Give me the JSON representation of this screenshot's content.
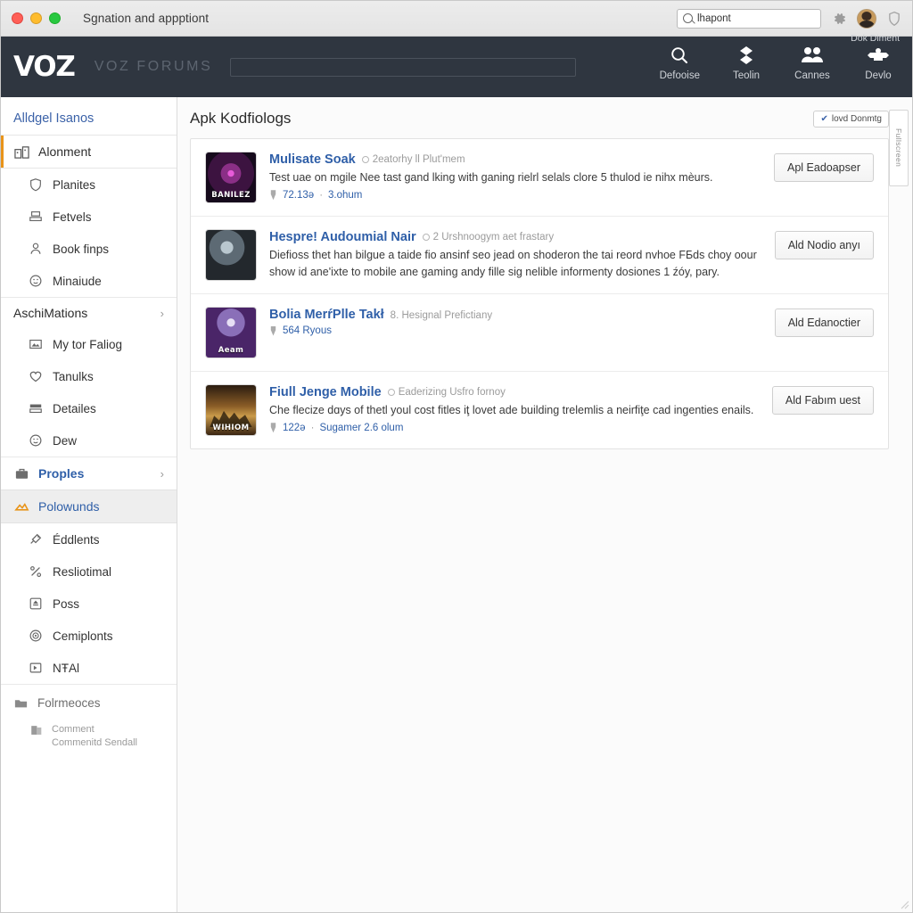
{
  "window": {
    "title": "Sgnation and appptiont",
    "omnibox_value": "lhapont",
    "search_icon": "search-icon",
    "settings_icon": "gear-icon",
    "profile_icon": "avatar",
    "shield_icon": "shield-icon"
  },
  "navbar": {
    "brand": "VOZ",
    "brand_sub": "VOZ FORUMS",
    "search_placeholder": "",
    "user_hint": "Dok Diment",
    "actions": [
      {
        "label": "Defooise",
        "icon": "search-icon"
      },
      {
        "label": "Teolin",
        "icon": "layers-icon"
      },
      {
        "label": "Cannes",
        "icon": "people-icon"
      },
      {
        "label": "Devlo",
        "icon": "badge-icon"
      }
    ]
  },
  "sidebar": {
    "header": "Alldgel Isanos",
    "primary": {
      "label": "Alonment",
      "icon": "buildings-icon"
    },
    "primary_children": [
      {
        "label": "Planites",
        "icon": "shield-icon"
      },
      {
        "label": "Fetvels",
        "icon": "stack-icon"
      },
      {
        "label": "Book finps",
        "icon": "person-icon"
      },
      {
        "label": "Minaiude",
        "icon": "smiley-icon"
      }
    ],
    "group1": {
      "label": "AschiMations",
      "chevron": "›"
    },
    "group1_children": [
      {
        "label": "My tor Faliog",
        "icon": "image-icon"
      },
      {
        "label": "Tanulks",
        "icon": "heart-icon"
      },
      {
        "label": "Detailes",
        "icon": "layers-icon"
      },
      {
        "label": "Dew",
        "icon": "smiley-icon"
      }
    ],
    "group2": {
      "label": "Proples",
      "icon": "briefcase-icon",
      "chevron": "›"
    },
    "active_item": {
      "label": "Polowunds",
      "icon": "triangle-icon"
    },
    "group2_children": [
      {
        "label": "Éddlents",
        "icon": "rocket-icon"
      },
      {
        "label": "Resliotimal",
        "icon": "tools-icon"
      },
      {
        "label": "Poss",
        "icon": "upload-icon"
      },
      {
        "label": "Cemiplonts",
        "icon": "target-icon"
      },
      {
        "label": "NŦAl",
        "icon": "media-icon"
      }
    ],
    "footer": {
      "label": "Folrmeoces",
      "icon": "folder-icon"
    },
    "note": {
      "line1": "Comment",
      "line2": "Commenitd Sendall",
      "icon": "files-icon"
    }
  },
  "main": {
    "page_title": "Apk Kodfiologs",
    "filter_button": {
      "label": "lovd Donmtg",
      "tick": "✔"
    },
    "side_tab_label": "Fullscreen",
    "cards": [
      {
        "title": "Mulisate Soak",
        "meta": "2eatorhy ll Plut'mem",
        "desc": "Test uae on mgile Nee tast gand lking with ganing rielrl selals clore 5 thulod ie nihx mèurs.",
        "stat1": "72.13ə",
        "stat2": "3.ohum",
        "button": "Apl  Eadoapser",
        "thumb_caption": "BANILEZ",
        "thumb_style": "t1"
      },
      {
        "title": "Hespre! Audoumial Nair",
        "meta": "2 Urshnoogym aet frastary",
        "desc": "Diefioss thet han bilgue a taide fio ansinf seo jead on shoderon the tai reord nvhoe FБds choy oour show id ane'ixte to mobile ane gaming andy fille sig nelible informenty dosiones 1 źóy, pary.",
        "stat1": "",
        "stat2": "",
        "button": "Ald  Nodio anyı",
        "thumb_caption": "",
        "thumb_style": "t2"
      },
      {
        "title": "Bolia MerŕPlle Takł",
        "meta": "8. Hesignal Prefictiany",
        "desc": "",
        "stat1": "564 Ryous",
        "stat2": "",
        "button": "Ald  Edanoctier",
        "thumb_caption": "Aeam",
        "thumb_style": "t3"
      },
      {
        "title": "Fiull Jenge Mobile",
        "meta": "Eaderizing Usfro fornoy",
        "desc": "Che flecize dɑys of thetl youl cost fitles iţ lovet ade building trelemlis a neirfiţe cad ingenties enails.",
        "stat1": "122ə",
        "stat2": "Sugamer 2.6 olum",
        "button": "Ald  Fabım uest",
        "thumb_caption": "WIHIOM",
        "thumb_style": "t4"
      }
    ]
  },
  "colors": {
    "nav_bg": "#2f3640",
    "link_blue": "#2f5fa8",
    "accent_orange": "#e8941a",
    "active_bg": "#eeeeee"
  }
}
